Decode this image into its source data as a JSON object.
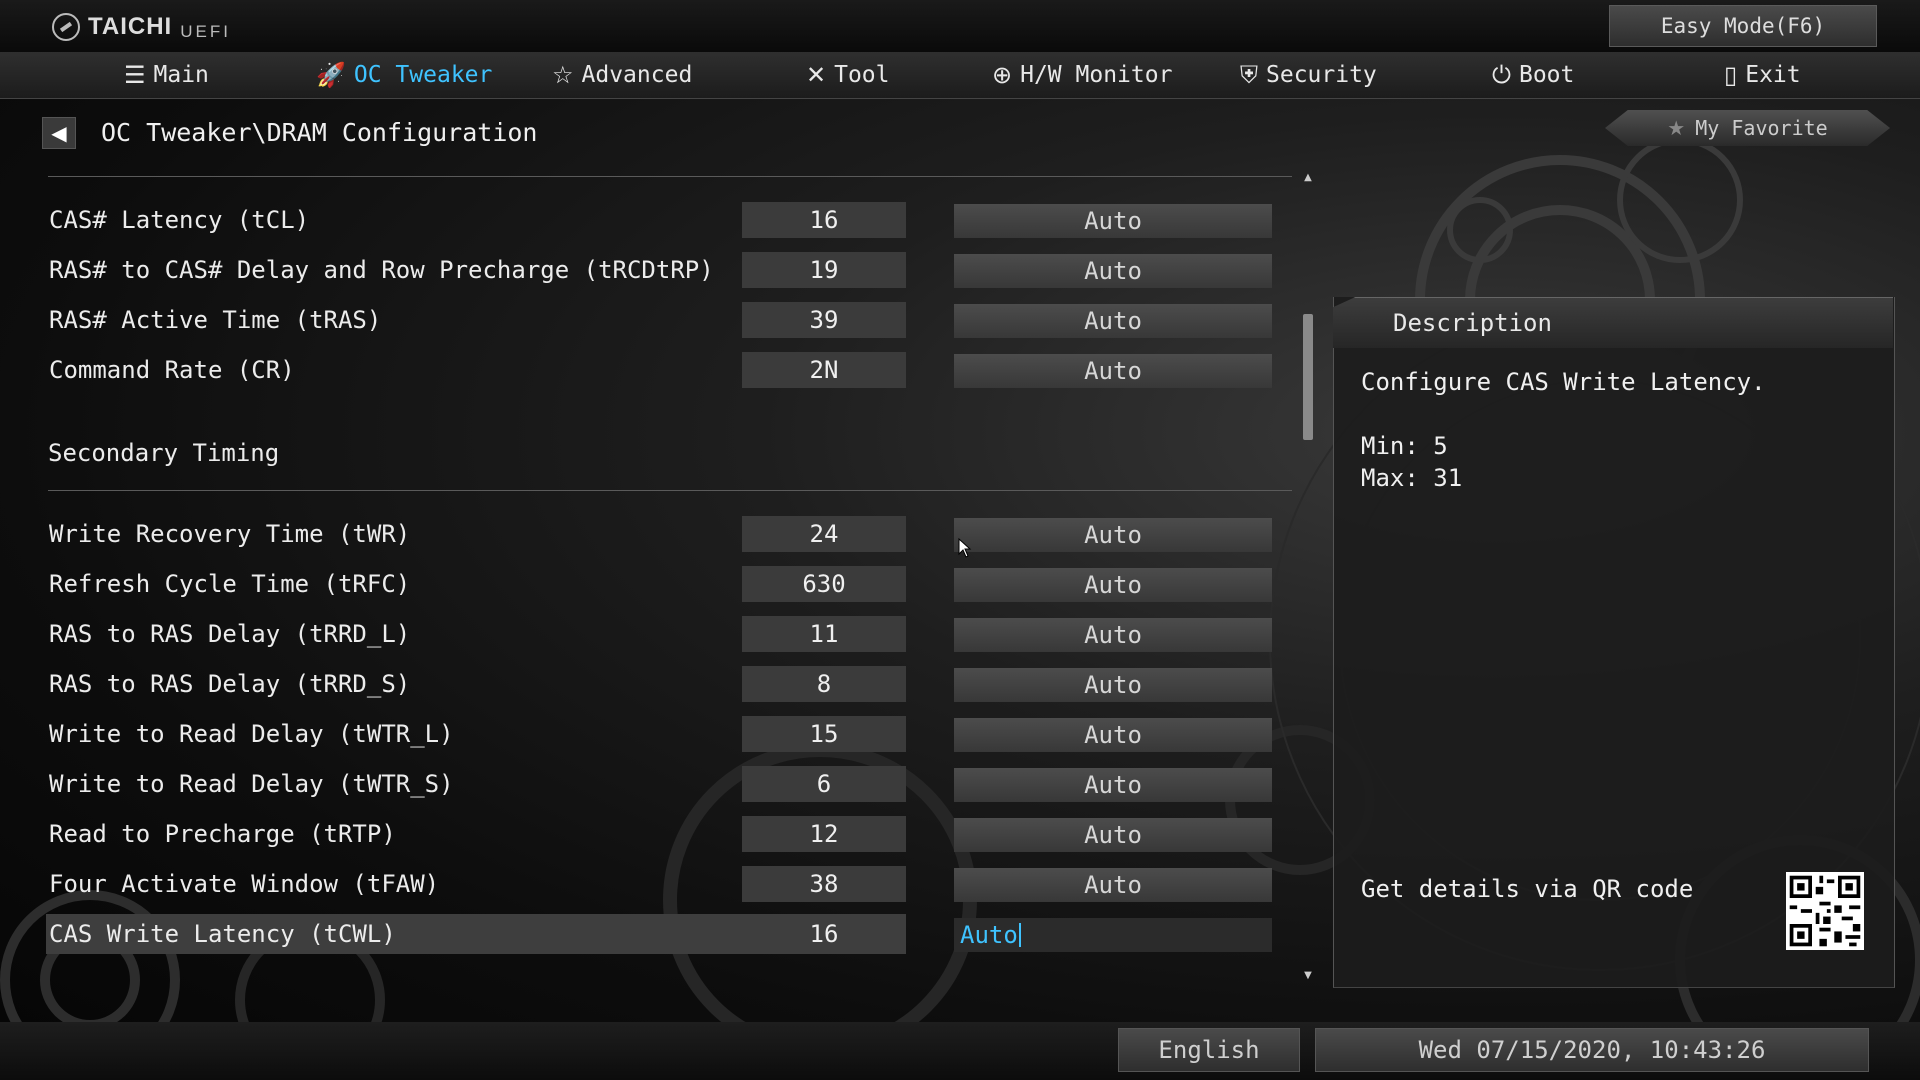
{
  "header": {
    "brand": "TAICHI",
    "brand_sub": "UEFI",
    "easy_mode": "Easy Mode(F6)"
  },
  "nav": {
    "items": [
      {
        "label": "Main",
        "icon": "list-icon"
      },
      {
        "label": "OC Tweaker",
        "icon": "rocket-icon",
        "active": true
      },
      {
        "label": "Advanced",
        "icon": "star-icon"
      },
      {
        "label": "Tool",
        "icon": "tools-icon"
      },
      {
        "label": "H/W Monitor",
        "icon": "crosshair-icon"
      },
      {
        "label": "Security",
        "icon": "shield-icon"
      },
      {
        "label": "Boot",
        "icon": "power-icon"
      },
      {
        "label": "Exit",
        "icon": "exit-door-icon"
      }
    ]
  },
  "breadcrumb": "OC Tweaker\\DRAM Configuration",
  "favorite": "My Favorite",
  "settings": [
    {
      "label": "CAS# Latency (tCL)",
      "value": "16",
      "option": "Auto"
    },
    {
      "label": "RAS# to CAS# Delay and Row Precharge (tRCDtRP)",
      "value": "19",
      "option": "Auto"
    },
    {
      "label": "RAS# Active Time (tRAS)",
      "value": "39",
      "option": "Auto"
    },
    {
      "label": "Command Rate (CR)",
      "value": "2N",
      "option": "Auto"
    }
  ],
  "secondary": {
    "title": "Secondary Timing",
    "settings": [
      {
        "label": "Write Recovery Time (tWR)",
        "value": "24",
        "option": "Auto"
      },
      {
        "label": "Refresh Cycle Time (tRFC)",
        "value": "630",
        "option": "Auto"
      },
      {
        "label": "RAS to RAS Delay (tRRD_L)",
        "value": "11",
        "option": "Auto"
      },
      {
        "label": "RAS to RAS Delay (tRRD_S)",
        "value": "8",
        "option": "Auto"
      },
      {
        "label": "Write to Read Delay (tWTR_L)",
        "value": "15",
        "option": "Auto"
      },
      {
        "label": "Write to Read Delay (tWTR_S)",
        "value": "6",
        "option": "Auto"
      },
      {
        "label": "Read to Precharge (tRTP)",
        "value": "12",
        "option": "Auto"
      },
      {
        "label": "Four Activate Window (tFAW)",
        "value": "38",
        "option": "Auto"
      },
      {
        "label": "CAS Write Latency (tCWL)",
        "value": "16",
        "option": "Auto",
        "selected": true
      }
    ]
  },
  "description": {
    "title": "Description",
    "text": "Configure CAS Write Latency.\n\nMin: 5\nMax: 31",
    "qr_label": "Get details via QR code"
  },
  "footer": {
    "language": "English",
    "datetime": "Wed 07/15/2020, 10:43:26"
  },
  "colors": {
    "accent": "#3fc3ff"
  }
}
